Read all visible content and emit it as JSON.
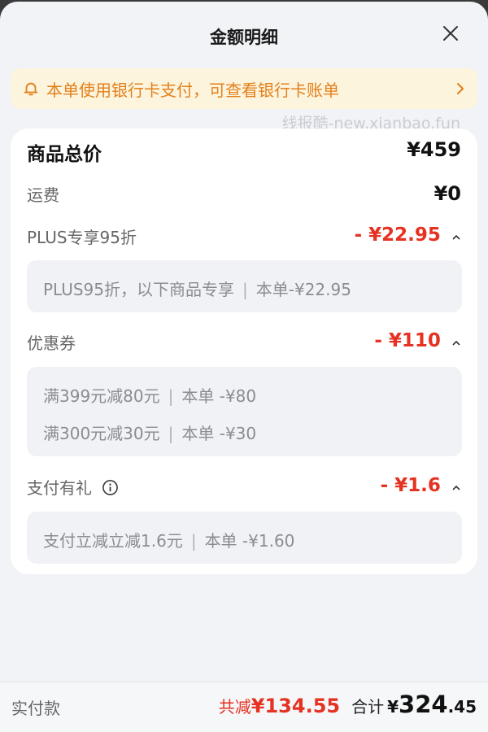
{
  "header": {
    "title": "金额明细"
  },
  "notice": {
    "text": "本单使用银行卡支付，可查看银行卡账单"
  },
  "watermark": "线报酷-new.xianbao.fun",
  "summary": {
    "goods_total_label": "商品总价",
    "goods_total_value": "¥459",
    "shipping_label": "运费",
    "shipping_value": "¥0"
  },
  "discounts": [
    {
      "label": "PLUS专享95折",
      "value": "- ¥22.95",
      "details": [
        {
          "text": "PLUS95折，以下商品专享",
          "order_label": "本单-¥22.95"
        }
      ]
    },
    {
      "label": "优惠券",
      "value": "- ¥110",
      "details": [
        {
          "text": "满399元减80元",
          "order_label": "本单 -¥80"
        },
        {
          "text": "满300元减30元",
          "order_label": "本单 -¥30"
        }
      ]
    },
    {
      "label": "支付有礼",
      "value": "- ¥1.6",
      "details": [
        {
          "text": "支付立减立减1.6元",
          "order_label": "本单 -¥1.60"
        }
      ]
    }
  ],
  "footer": {
    "label": "实付款",
    "saved_label": "共减",
    "saved_value": "¥134.55",
    "total_label": "合计",
    "total_currency": "¥",
    "total_integer": "324",
    "total_decimal": ".45"
  },
  "colors": {
    "accent_red": "#e53222",
    "notice_orange": "#e2801a",
    "notice_bg": "#fdf4de"
  },
  "icons": [
    "close-icon",
    "bell-icon",
    "chevron-right-icon",
    "caret-up-icon",
    "info-icon"
  ]
}
